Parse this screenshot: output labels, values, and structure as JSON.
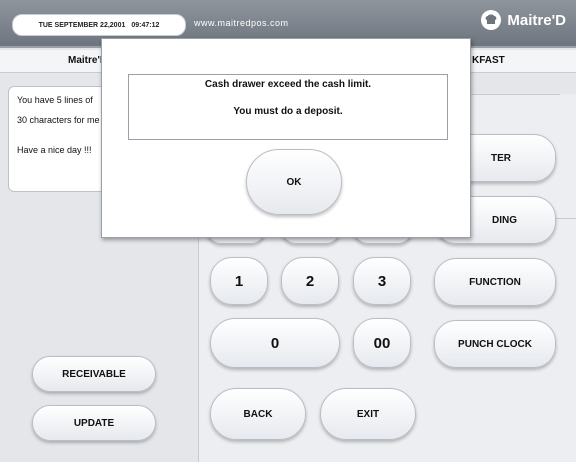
{
  "topbar": {
    "date": "TUE SEPTEMBER 22,2001",
    "time": "09:47:12",
    "url": "www.maitredpos.com",
    "brand": "Maitre'D"
  },
  "header": {
    "left_label": "Maitre'D",
    "right_label": "KFAST"
  },
  "message_panel": {
    "line1": "You have 5 lines of",
    "line2": "30 characters for me",
    "line3": "Have a nice day !!!"
  },
  "left_buttons": {
    "receivable": "RECEIVABLE",
    "update": "UPDATE"
  },
  "keypad": {
    "k1": "1",
    "k2": "2",
    "k3": "3",
    "k0": "0",
    "k00": "00",
    "back": "BACK",
    "exit": "EXIT"
  },
  "right_buttons": {
    "enter_partial": "TER",
    "ending_partial": "DING",
    "function": "FUNCTION",
    "punch_clock": "PUNCH CLOCK"
  },
  "dialog": {
    "line1": "Cash drawer exceed the cash limit.",
    "line2": "You must do a deposit.",
    "ok": "OK"
  }
}
